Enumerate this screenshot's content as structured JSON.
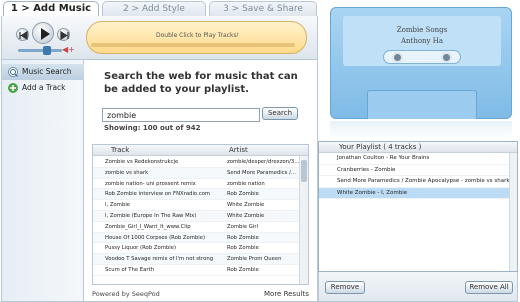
{
  "tabs": [
    {
      "label": "1 > Add Music"
    },
    {
      "label": "2 > Add Style"
    },
    {
      "label": "3 > Save & Share"
    }
  ],
  "player": {
    "track_text": "Double Click to Play Tracks!",
    "icons": [
      "prev-icon",
      "play-icon",
      "next-icon",
      "volume-icon"
    ]
  },
  "sidebar": {
    "items": [
      {
        "label": "Music Search",
        "icon": "search-icon"
      },
      {
        "label": "Add a Track",
        "icon": "add-icon"
      }
    ]
  },
  "search": {
    "heading": "Search the web for music that can be added to your playlist.",
    "query": "zombie",
    "button_label": "Search",
    "showing": "Showing: 100 out of 942"
  },
  "results": {
    "columns": [
      "Track",
      "Artist"
    ],
    "rows": [
      {
        "track": "Zombie vs Redekonstrukcje",
        "artist": "zombie/desper/drexzon/3..."
      },
      {
        "track": "zombie vs shark",
        "artist": "Send More Paramedics /..."
      },
      {
        "track": "zombie nation- uni prossent remix",
        "artist": "zombie nation"
      },
      {
        "track": "Rob Zombie interview on FNXradio.com",
        "artist": "Rob Zombie"
      },
      {
        "track": "I, Zombie",
        "artist": "White Zombie"
      },
      {
        "track": "I, Zombie (Europe In The Raw Mix)",
        "artist": "White Zombie"
      },
      {
        "track": "Zombie_Girl_I_Want_It_www.Clip",
        "artist": "Zombie Girl"
      },
      {
        "track": "House Of 1000 Corpses (Rob Zombie)",
        "artist": "Rob Zombie"
      },
      {
        "track": "Pussy Liquor (Rob Zombie)",
        "artist": "Rob Zombie"
      },
      {
        "track": "Voodoo T Savage remix of I'm not strong",
        "artist": "Zombie Prom Queen"
      },
      {
        "track": "Scum of The Earth",
        "artist": "Rob Zombie"
      }
    ],
    "powered_by": "Powered by SeeqPod",
    "more_label": "More Results"
  },
  "cassette": {
    "title": "Zombie Songs",
    "artist": "Anthony Ha"
  },
  "playlist": {
    "header": "Your Playlist  ( 4 tracks )",
    "items": [
      {
        "label": "Jonathan Coulton - Re Your Brains"
      },
      {
        "label": "Cranberries - Zombie"
      },
      {
        "label": "Send More Paramedics / Zombie Apocalypse - zombie vs shark"
      },
      {
        "label": "White Zombie - I, Zombie"
      }
    ],
    "remove_label": "Remove",
    "remove_all_label": "Remove All"
  },
  "colors": {
    "accent": "#3d78b0",
    "cassette": "#8fc6ec",
    "selected_row": "#bcdcf5"
  }
}
